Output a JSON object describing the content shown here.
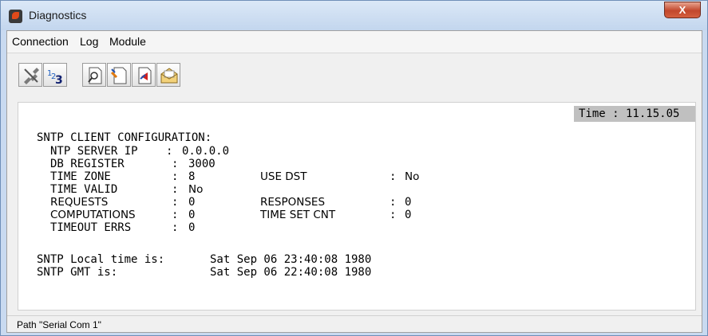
{
  "window": {
    "title": "Diagnostics",
    "close_glyph": "X"
  },
  "menu": [
    "Connection",
    "Log",
    "Module"
  ],
  "toolbar": [
    "disconnect-icon",
    "serial-icon",
    "search-document-icon",
    "edit-document-icon",
    "send-document-icon",
    "open-envelope-icon"
  ],
  "console": {
    "time_label": "Time : 11.15.05",
    "heading": "SNTP CLIENT CONFIGURATION:",
    "fields": [
      {
        "label": "NTP SERVER IP",
        "value": "0.0.0.0"
      },
      {
        "label": "DB REGISTER",
        "value": "3000"
      },
      {
        "label": "TIME ZONE",
        "value": "8"
      },
      {
        "label": "TIME VALID",
        "value": "No"
      },
      {
        "label": "REQUESTS",
        "value": "0"
      },
      {
        "label": "COMPUTATIONS",
        "value": "0"
      },
      {
        "label": "TIMEOUT ERRS",
        "value": "0"
      }
    ],
    "right_fields": [
      {
        "label": "USE DST",
        "value": "No"
      },
      {
        "label": "RESPONSES",
        "value": "0"
      },
      {
        "label": "TIME SET CNT",
        "value": "0"
      }
    ],
    "local_time_label": "SNTP Local time is:",
    "local_time_value": "Sat Sep 06 23:40:08 1980",
    "gmt_label": "SNTP GMT is:",
    "gmt_value": "Sat Sep 06 22:40:08 1980"
  },
  "status": {
    "path": "Path \"Serial Com 1\""
  }
}
